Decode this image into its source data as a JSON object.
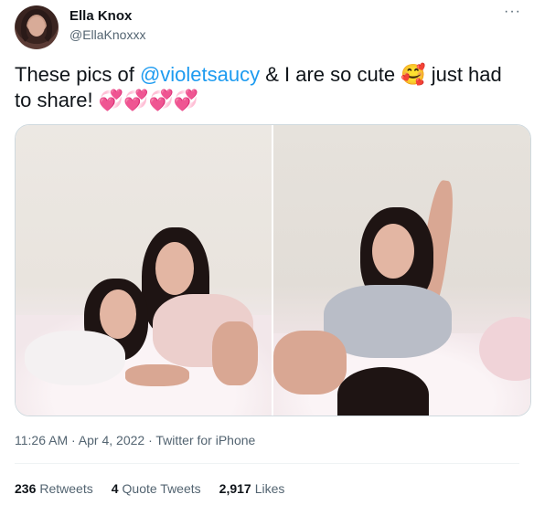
{
  "author": {
    "name": "Ella Knox",
    "handle": "@EllaKnoxxx"
  },
  "tweet": {
    "text_before": "These pics of ",
    "mention": "@violetsaucy",
    "text_after": " & I are so cute 🥰 just had to share! 💞💞💞💞"
  },
  "more_label": "···",
  "meta": {
    "time": "11:26 AM",
    "sep1": " · ",
    "date": "Apr 4, 2022",
    "sep2": " · ",
    "source": "Twitter for iPhone"
  },
  "stats": {
    "retweets_count": "236",
    "retweets_label": "Retweets",
    "quotes_count": "4",
    "quotes_label": "Quote Tweets",
    "likes_count": "2,917",
    "likes_label": "Likes"
  },
  "colors": {
    "link": "#1d9bf0",
    "secondary_text": "#536471",
    "border": "#cfd9de"
  }
}
